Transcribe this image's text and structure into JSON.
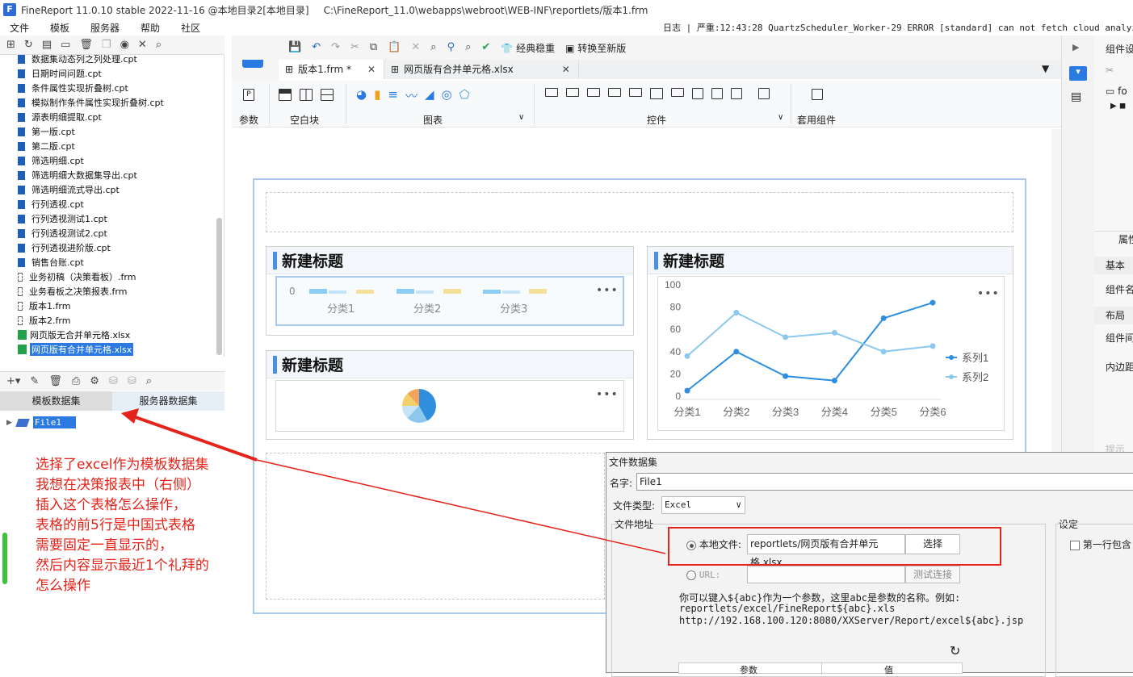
{
  "app": {
    "title": "FineReport 11.0.10 stable 2022-11-16 @本地目录2[本地目录]",
    "path": "C:\\FineReport_11.0\\webapps\\webroot\\WEB-INF\\reportlets/版本1.frm"
  },
  "menu": [
    "文件",
    "模板",
    "服务器",
    "帮助",
    "社区"
  ],
  "log": "日志 | 严重:12:43:28 QuartzScheduler_Worker-29 ERROR [standard] can not fetch cloud analyze token",
  "files": [
    {
      "name": "数据集动态列之列处理.cpt",
      "type": "cpt"
    },
    {
      "name": "日期时间问题.cpt",
      "type": "cpt"
    },
    {
      "name": "条件属性实现折叠树.cpt",
      "type": "cpt"
    },
    {
      "name": "模拟制作条件属性实现折叠树.cpt",
      "type": "cpt"
    },
    {
      "name": "源表明细提取.cpt",
      "type": "cpt"
    },
    {
      "name": "第一版.cpt",
      "type": "cpt"
    },
    {
      "name": "第二版.cpt",
      "type": "cpt"
    },
    {
      "name": "筛选明细.cpt",
      "type": "cpt"
    },
    {
      "name": "筛选明细大数据集导出.cpt",
      "type": "cpt"
    },
    {
      "name": "筛选明细流式导出.cpt",
      "type": "cpt"
    },
    {
      "name": "行列透视.cpt",
      "type": "cpt"
    },
    {
      "name": "行列透视测试1.cpt",
      "type": "cpt"
    },
    {
      "name": "行列透视测试2.cpt",
      "type": "cpt"
    },
    {
      "name": "行列透视进阶版.cpt",
      "type": "cpt"
    },
    {
      "name": "销售台账.cpt",
      "type": "cpt"
    },
    {
      "name": "业务初稿（决策看板）.frm",
      "type": "frm"
    },
    {
      "name": "业务看板之决策报表.frm",
      "type": "frm"
    },
    {
      "name": "版本1.frm",
      "type": "frm"
    },
    {
      "name": "版本2.frm",
      "type": "frm"
    },
    {
      "name": "网页版无合并单元格.xlsx",
      "type": "xls"
    },
    {
      "name": "网页版有合并单元格.xlsx",
      "type": "xls",
      "selected": true
    }
  ],
  "dataset_tabs": {
    "template": "模板数据集",
    "server": "服务器数据集"
  },
  "dataset_item": "File1",
  "note_lines": [
    "选择了excel作为模板数据集",
    "我想在决策报表中（右侧）",
    "插入这个表格怎么操作，",
    "表格的前5行是中国式表格",
    "需要固定一直显示的，",
    "然后内容显示最近1个礼拜的",
    "怎么操作"
  ],
  "toolbar": {
    "classic": "经典稳重",
    "convert": "转换至新版"
  },
  "tabs": [
    {
      "label": "版本1.frm *",
      "active": true
    },
    {
      "label": "网页版有合并单元格.xlsx",
      "active": false
    }
  ],
  "ribbon": {
    "param": "参数",
    "blank": "空白块",
    "chart": "图表",
    "control": "控件",
    "component": "套用组件"
  },
  "widgets": {
    "title": "新建标题"
  },
  "bar_categories": [
    "分类1",
    "分类2",
    "分类3"
  ],
  "bar_zero": "0",
  "colors": {
    "series1": "#2f8fde",
    "series2": "#8cc8ee",
    "accent": "#4a90e2",
    "red": "#e4241a"
  },
  "chart_data": {
    "type": "line",
    "categories": [
      "分类1",
      "分类2",
      "分类3",
      "分类4",
      "分类5",
      "分类6"
    ],
    "series": [
      {
        "name": "系列1",
        "values": [
          5,
          40,
          18,
          14,
          70,
          84
        ]
      },
      {
        "name": "系列2",
        "values": [
          36,
          75,
          53,
          57,
          40,
          45
        ]
      }
    ],
    "ylim": [
      0,
      100
    ],
    "yticks": [
      "0",
      "20",
      "40",
      "60",
      "80",
      "100"
    ],
    "legend": "right"
  },
  "right_panel": {
    "title": "组件设",
    "attr": "属性",
    "basic": "基本",
    "name": "组件名",
    "layout": "布局",
    "gap": "组件间",
    "padding": "内边距",
    "hint": "提示"
  },
  "dialog": {
    "title": "文件数据集",
    "name_label": "名字:",
    "name_value": "File1",
    "type_label": "文件类型:",
    "type_value": "Excel",
    "addr_label": "文件地址",
    "local_label": "本地文件:",
    "local_value": "reportlets/网页版有合并单元格.xlsx",
    "choose": "选择",
    "url_label": "URL:",
    "test": "测试连接",
    "hint1": "你可以键入${abc}作为一个参数，这里abc是参数的名称。例如:",
    "hint2": "reportlets/excel/FineReport${abc}.xls",
    "hint3": "http://192.168.100.120:8080/XXServer/Report/excel${abc}.jsp",
    "settings": "设定",
    "first_row": "第一行包含",
    "col_param": "参数",
    "col_value": "值"
  }
}
